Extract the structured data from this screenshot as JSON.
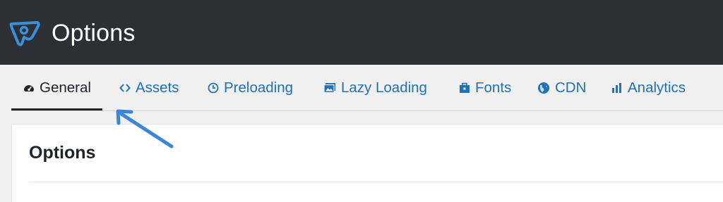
{
  "header": {
    "title": "Options",
    "logo_icon": "perfmatters-logo-icon",
    "background": "#2c3034",
    "logo_color": "#3b8fd9"
  },
  "tabs": [
    {
      "label": "General",
      "icon": "dashboard-gauge-icon",
      "active": true
    },
    {
      "label": "Assets",
      "icon": "code-brackets-icon",
      "active": false
    },
    {
      "label": "Preloading",
      "icon": "clock-icon",
      "active": false
    },
    {
      "label": "Lazy Loading",
      "icon": "images-icon",
      "active": false
    },
    {
      "label": "Fonts",
      "icon": "briefcase-icon",
      "active": false
    },
    {
      "label": "CDN",
      "icon": "globe-icon",
      "active": false
    },
    {
      "label": "Analytics",
      "icon": "bar-chart-icon",
      "active": false
    }
  ],
  "panel": {
    "title": "Options"
  },
  "colors": {
    "tab_link": "#2271b1",
    "tab_active": "#1d2327",
    "annotation_arrow": "#3b86d8"
  }
}
